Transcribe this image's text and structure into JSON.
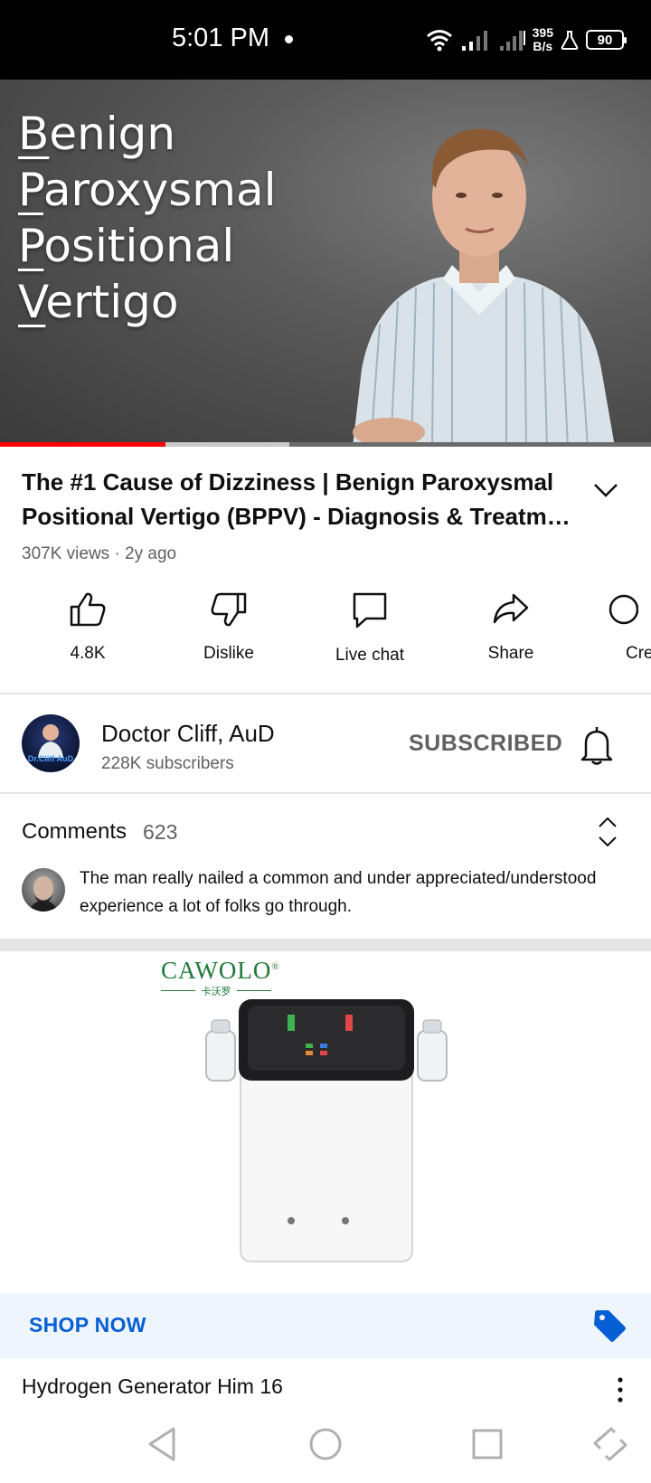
{
  "status_bar": {
    "time": "5:01 PM",
    "speed_value": "395",
    "speed_unit": "B/s",
    "battery": "90"
  },
  "video": {
    "overlay_lines": [
      "Benign",
      "Paroxysmal",
      "Positional",
      "Vertigo"
    ],
    "overlay_first_letters": [
      "B",
      "P",
      "P",
      "V"
    ],
    "overlay_rest": [
      "enign",
      "aroxysmal",
      "ositional",
      "ertigo"
    ],
    "progress_played_fraction": 0.254,
    "progress_buffered_fraction": 0.444
  },
  "title": {
    "line1": "The #1 Cause of Dizziness | Benign Paroxysmal",
    "line2": "Positional Vertigo (BPPV) - Diagnosis & Treatm…"
  },
  "meta": "307K views · 2y ago",
  "actions": {
    "like": "4.8K",
    "dislike": "Dislike",
    "live_chat": "Live chat",
    "share": "Share",
    "create": "Cre"
  },
  "channel": {
    "name": "Doctor Cliff, AuD",
    "subscribers": "228K subscribers",
    "subscribe_state": "SUBSCRIBED",
    "avatar_text": "Dr.Cliff AuD"
  },
  "comments": {
    "label": "Comments",
    "count": "623",
    "top_comment": "The man really nailed a common and under appreciated/understood experience a lot of folks go through."
  },
  "ad": {
    "brand": "CAWOLO",
    "brand_mark": "®",
    "brand_sub": "卡沃罗",
    "cta": "SHOP NOW",
    "title": "Hydrogen Generator Him 16"
  },
  "colors": {
    "progress_played": "#ff0000",
    "link_blue": "#065fd4",
    "brand_green": "#1f7a3a"
  },
  "icons": [
    "wifi-icon",
    "signal-icon",
    "flask-icon",
    "battery-icon",
    "chevron-down-icon",
    "thumbs-up-icon",
    "thumbs-down-icon",
    "chat-icon",
    "share-icon",
    "create-icon",
    "bell-icon",
    "sort-icon",
    "tag-icon",
    "kebab-icon",
    "back-icon",
    "home-icon",
    "recents-icon",
    "rotate-icon"
  ]
}
